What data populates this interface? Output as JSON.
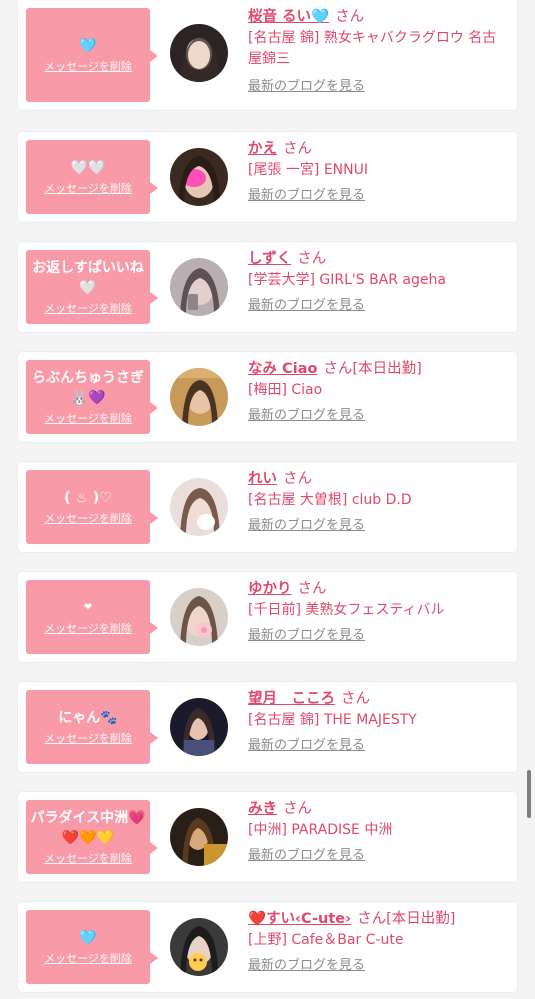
{
  "delete_label": "メッセージを削除",
  "blog_label": "最新のブログを見る",
  "san_label": "さん",
  "entries": [
    {
      "message": "🩵",
      "name": "桜音 るい🩵",
      "status": "",
      "shop": "[名古屋 錦] 熟女キャバクラグロウ 名古屋錦三"
    },
    {
      "message": "🤍🤍",
      "name": "かえ",
      "status": "",
      "shop": "[尾張 一宮] ENNUI"
    },
    {
      "message": "お返しすぱいいね🤍",
      "name": "しずく",
      "status": "",
      "shop": "[学芸大学] GIRL'S BAR ageha"
    },
    {
      "message": "らぶんちゅうさぎ🐰💜",
      "name": "なみ Ciao",
      "status": "[本日出勤]",
      "shop": "[梅田] Ciao"
    },
    {
      "message": "( ♨ )♡",
      "name": "れい",
      "status": "",
      "shop": "[名古屋 大曽根] club D.D"
    },
    {
      "message": "❤",
      "name": "ゆかり",
      "status": "",
      "shop": "[千日前] 美熟女フェスティバル"
    },
    {
      "message": "にゃん🐾",
      "name": "望月　こころ",
      "status": "",
      "shop": "[名古屋 錦] THE MAJESTY"
    },
    {
      "message": "パラダイス中洲💗❤️🧡💛",
      "name": "みき",
      "status": "",
      "shop": "[中洲] PARADISE 中洲"
    },
    {
      "message": "🩵",
      "name": "❤️すい‹C-ute›",
      "status": "[本日出勤]",
      "shop": "[上野] Cafe＆Bar C-ute"
    }
  ],
  "colors": {
    "bubble": "#f89aa7",
    "name": "#e2486c",
    "link_gray": "#8c8c8c",
    "background": "#f4f4f4"
  }
}
